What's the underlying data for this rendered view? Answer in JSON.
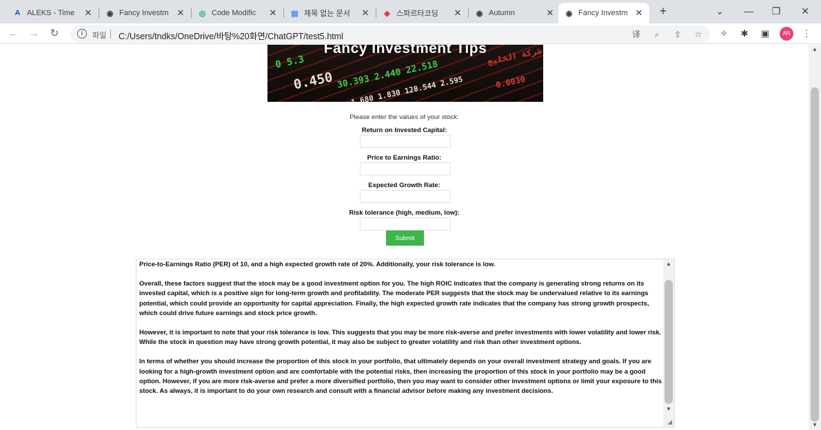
{
  "browser": {
    "tabs": [
      {
        "label": "ALEKS - Time",
        "icon": "aleks-icon",
        "glyph": "A",
        "color": "#1a56b0"
      },
      {
        "label": "Fancy Investm",
        "icon": "globe-icon",
        "glyph": "◉",
        "color": "#3c4043"
      },
      {
        "label": "Code Modific",
        "icon": "openai-icon",
        "glyph": "◎",
        "color": "#10a37f"
      },
      {
        "label": "제목 없는 문서",
        "icon": "docs-icon",
        "glyph": "▤",
        "color": "#4285f4"
      },
      {
        "label": "스파르타코딩",
        "icon": "sparta-icon",
        "glyph": "◆",
        "color": "#e8344e"
      },
      {
        "label": "Autumn",
        "icon": "globe-icon",
        "glyph": "◉",
        "color": "#3c4043"
      },
      {
        "label": "Fancy Investm",
        "icon": "globe-icon",
        "glyph": "◉",
        "color": "#3c4043",
        "active": true
      }
    ],
    "new_tab_symbol": "+",
    "window_controls": {
      "dropdown": "⌄",
      "minimize": "—",
      "restore": "❐",
      "close": "✕"
    },
    "nav": {
      "back": "←",
      "forward": "→",
      "reload": "↻"
    },
    "address": {
      "info_glyph": "i",
      "scheme_label": "파일",
      "url": "C:/Users/tndks/OneDrive/바탕%20화면/ChatGPT/test5.html"
    },
    "omnibox_icons": {
      "translate": "译",
      "zoom": "⌕",
      "share": "⇪",
      "bookmark": "☆"
    },
    "toolbar_icons": {
      "extension1": "✧",
      "extensions": "✱",
      "sidepanel": "▣",
      "menu": "⋮"
    },
    "profile_initials": "AN"
  },
  "page": {
    "banner": {
      "title": "Fancy Investment Tips",
      "tickers": [
        {
          "text": "0   5.3",
          "color": "green",
          "size": 14
        },
        {
          "text": "0.450",
          "color": "white",
          "size": 19
        },
        {
          "text": "30.393   2.440   22.518",
          "color": "green",
          "size": 13
        },
        {
          "text": "1.680   1.830   128.544   2.595",
          "color": "white",
          "size": 11
        },
        {
          "text": "شركة الخليج",
          "color": "red",
          "size": 12
        },
        {
          "text": "0.0030",
          "color": "red",
          "size": 12
        }
      ]
    },
    "prompt": "Please enter the values of your stock:",
    "fields": [
      {
        "label": "Return on Invested Capital:",
        "value": ""
      },
      {
        "label": "Price to Earnings Ratio:",
        "value": ""
      },
      {
        "label": "Expected Growth Rate:",
        "value": ""
      },
      {
        "label": "Risk tolerance (high, medium, low):",
        "value": ""
      }
    ],
    "submit_label": "Submit",
    "result": {
      "paragraphs": [
        "Price-to-Earnings Ratio (PER) of 10, and a high expected growth rate of 20%. Additionally, your risk tolerance is low.",
        "Overall, these factors suggest that the stock may be a good investment option for you. The high ROIC indicates that the company is generating strong returns on its invested capital, which is a positive sign for long-term growth and profitability. The moderate PER suggests that the stock may be undervalued relative to its earnings potential, which could provide an opportunity for capital appreciation. Finally, the high expected growth rate indicates that the company has strong growth prospects, which could drive future earnings and stock price growth.",
        "However, it is important to note that your risk tolerance is low. This suggests that you may be more risk-averse and prefer investments with lower volatility and lower risk. While the stock in question may have strong growth potential, it may also be subject to greater volatility and risk than other investment options.",
        "In terms of whether you should increase the proportion of this stock in your portfolio, that ultimately depends on your overall investment strategy and goals. If you are looking for a high-growth investment option and are comfortable with the potential risks, then increasing the proportion of this stock in your portfolio may be a good option. However, if you are more risk-averse and prefer a more diversified portfolio, then you may want to consider other investment options or limit your exposure to this stock. As always, it is important to do your own research and consult with a financial advisor before making any investment decisions."
      ]
    },
    "scroll_up_symbol": "▲",
    "scroll_down_symbol": "▼",
    "resize_grip_symbol": "◢"
  }
}
